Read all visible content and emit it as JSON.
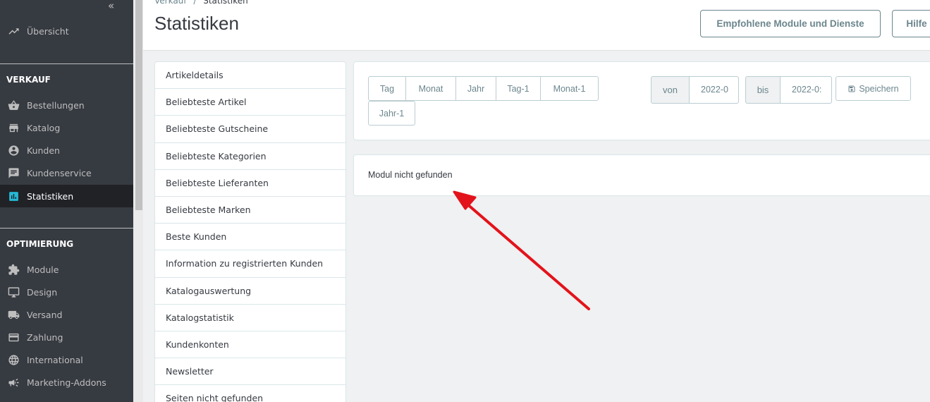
{
  "sidebar": {
    "collapse_icon": "double-chevron-left-icon",
    "top_item": {
      "label": "Übersicht",
      "icon": "trending-up-icon"
    },
    "sections": [
      {
        "title": "VERKAUF"
      },
      {
        "title": "OPTIMIERUNG"
      }
    ],
    "items": [
      {
        "label": "Bestellungen",
        "icon": "basket-icon"
      },
      {
        "label": "Katalog",
        "icon": "store-icon"
      },
      {
        "label": "Kunden",
        "icon": "account-circle-icon"
      },
      {
        "label": "Kundenservice",
        "icon": "chat-icon"
      },
      {
        "label": "Statistiken",
        "icon": "bar-chart-icon",
        "active": true
      },
      {
        "label": "Module",
        "icon": "puzzle-icon"
      },
      {
        "label": "Design",
        "icon": "desktop-icon"
      },
      {
        "label": "Versand",
        "icon": "truck-icon"
      },
      {
        "label": "Zahlung",
        "icon": "credit-card-icon"
      },
      {
        "label": "International",
        "icon": "globe-icon"
      },
      {
        "label": "Marketing-Addons",
        "icon": "megaphone-icon"
      }
    ],
    "active_color": "#25b9d7"
  },
  "header": {
    "breadcrumb": {
      "parent": "Verkauf",
      "separator": "/",
      "current": "Statistiken"
    },
    "title": "Statistiken",
    "buttons": {
      "recommended": "Empfohlene Module und Dienste",
      "help": "Hilfe"
    }
  },
  "stats_modules": [
    "Artikeldetails",
    "Beliebteste Artikel",
    "Beliebteste Gutscheine",
    "Beliebteste Kategorien",
    "Beliebteste Lieferanten",
    "Beliebteste Marken",
    "Beste Kunden",
    "Information zu registrierten Kunden",
    "Katalogauswertung",
    "Katalogstatistik",
    "Kundenkonten",
    "Newsletter",
    "Seiten nicht gefunden"
  ],
  "calendar": {
    "periods": [
      "Tag",
      "Monat",
      "Jahr",
      "Tag-1",
      "Monat-1",
      "Jahr-1"
    ],
    "from_label": "von",
    "from_value": "2022-0",
    "to_label": "bis",
    "to_value": "2022-0:",
    "save_label": "Speichern",
    "save_icon": "floppy-disk-icon"
  },
  "content": {
    "message": "Modul nicht gefunden"
  },
  "annotation": {
    "arrow_color": "#e3131b",
    "arrow_icon": "red-arrow-annotation"
  }
}
